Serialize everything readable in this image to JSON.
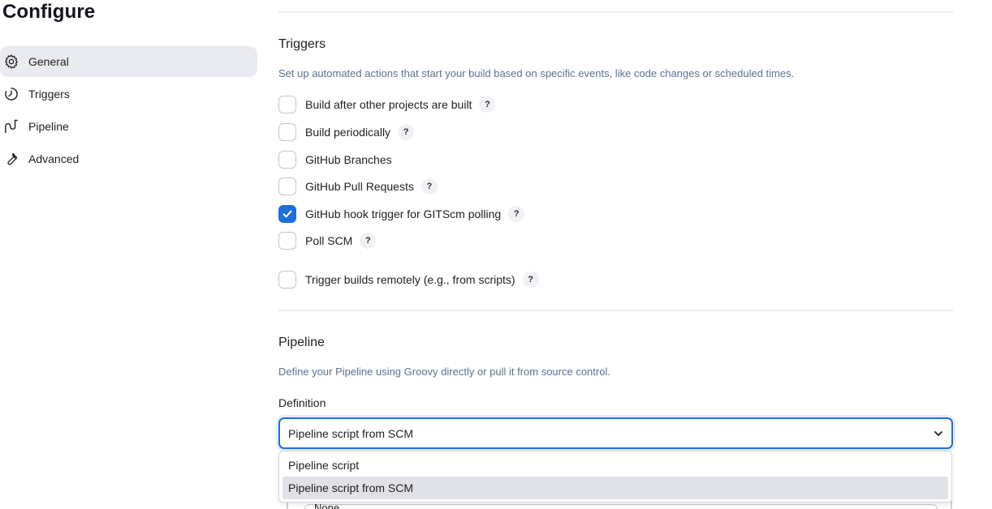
{
  "page": {
    "title": "Configure"
  },
  "sidebar": {
    "items": [
      {
        "label": "General",
        "icon": "gear-icon",
        "active": true
      },
      {
        "label": "Triggers",
        "icon": "timer-icon",
        "active": false
      },
      {
        "label": "Pipeline",
        "icon": "pipeline-icon",
        "active": false
      },
      {
        "label": "Advanced",
        "icon": "wrench-icon",
        "active": false
      }
    ]
  },
  "triggers": {
    "title": "Triggers",
    "description": "Set up automated actions that start your build based on specific events, like code changes or scheduled times.",
    "options": [
      {
        "label": "Build after other projects are built",
        "checked": false,
        "help": "?"
      },
      {
        "label": "Build periodically",
        "checked": false,
        "help": "?"
      },
      {
        "label": "GitHub Branches",
        "checked": false,
        "help": ""
      },
      {
        "label": "GitHub Pull Requests",
        "checked": false,
        "help": "?"
      },
      {
        "label": "GitHub hook trigger for GITScm polling",
        "checked": true,
        "help": "?"
      },
      {
        "label": "Poll SCM",
        "checked": false,
        "help": "?"
      },
      {
        "label": "Trigger builds remotely (e.g., from scripts)",
        "checked": false,
        "help": "?"
      }
    ]
  },
  "pipeline": {
    "title": "Pipeline",
    "description": "Define your Pipeline using Groovy directly or pull it from source control.",
    "definition_label": "Definition",
    "definition_value": "Pipeline script from SCM",
    "definition_options": [
      {
        "label": "Pipeline script",
        "highlighted": false
      },
      {
        "label": "Pipeline script from SCM",
        "highlighted": true
      }
    ],
    "scm_value_partial": "None"
  },
  "colors": {
    "accent": "#1f6fd9",
    "description": "#5c7390",
    "active_nav_bg": "#e9ebf0"
  }
}
